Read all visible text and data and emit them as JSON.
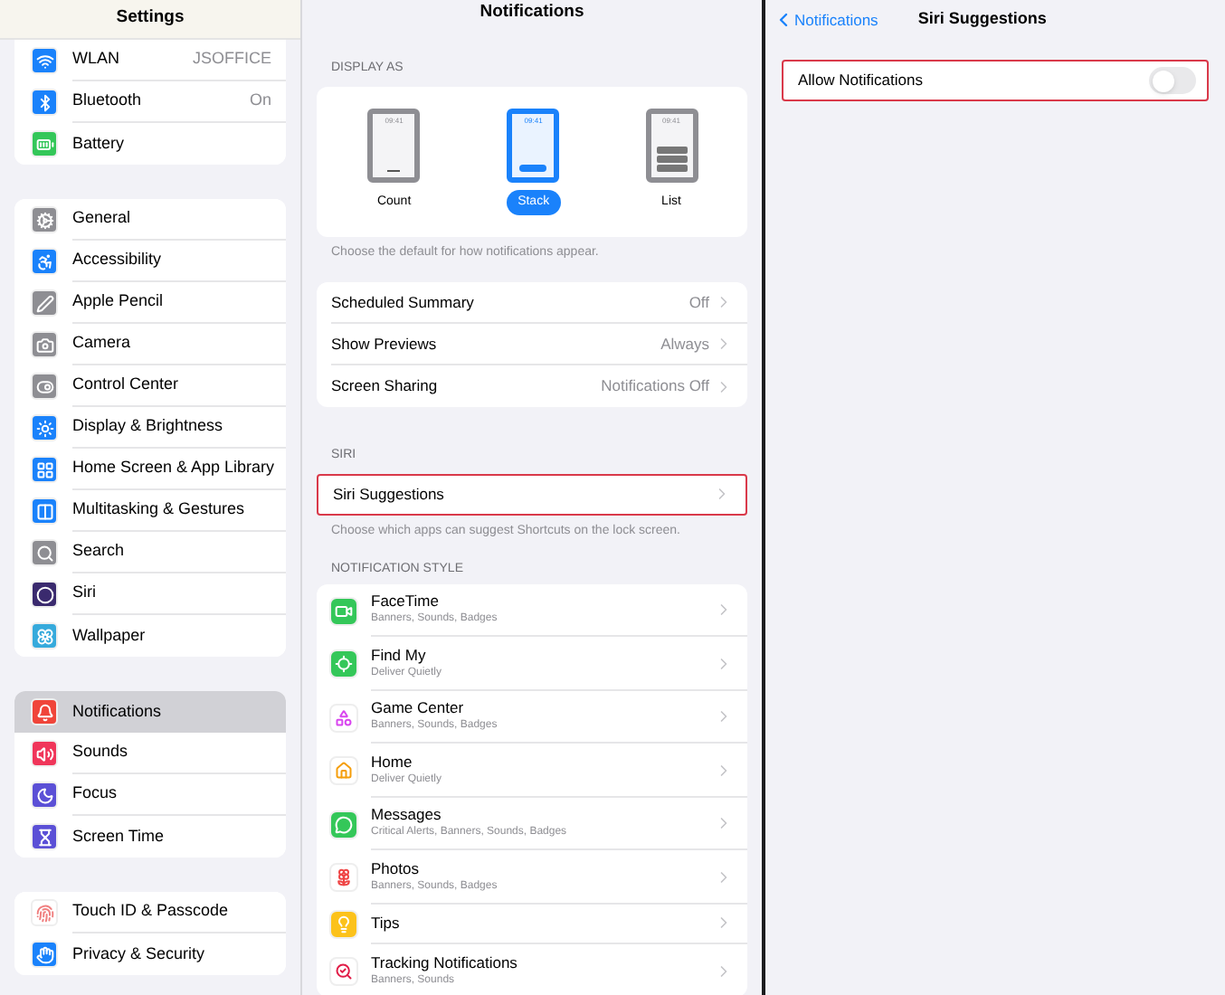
{
  "sidebar": {
    "title": "Settings",
    "groups": [
      [
        {
          "label": "WLAN",
          "value": "JSOFFICE",
          "color": "#1a82fb",
          "selected": false
        },
        {
          "label": "Bluetooth",
          "value": "On",
          "color": "#1a82fb",
          "selected": false
        },
        {
          "label": "Battery",
          "color": "#34c759",
          "selected": false
        }
      ],
      [
        {
          "label": "General",
          "color": "#8e8e93",
          "selected": false
        },
        {
          "label": "Accessibility",
          "color": "#1a82fb",
          "selected": false
        },
        {
          "label": "Apple Pencil",
          "color": "#8e8e93",
          "selected": false
        },
        {
          "label": "Camera",
          "color": "#8e8e93",
          "selected": false
        },
        {
          "label": "Control Center",
          "color": "#8e8e93",
          "selected": false
        },
        {
          "label": "Display & Brightness",
          "color": "#1a82fb",
          "selected": false
        },
        {
          "label": "Home Screen & App Library",
          "color": "#1a82fb",
          "selected": false
        },
        {
          "label": "Multitasking & Gestures",
          "color": "#1a82fb",
          "selected": false
        },
        {
          "label": "Search",
          "color": "#8e8e93",
          "selected": false
        },
        {
          "label": "Siri",
          "color": "#3a2a6e",
          "selected": false
        },
        {
          "label": "Wallpaper",
          "color": "#36aadc",
          "selected": false
        }
      ],
      [
        {
          "label": "Notifications",
          "color": "#f0453a",
          "selected": true
        },
        {
          "label": "Sounds",
          "color": "#f0365a",
          "selected": false
        },
        {
          "label": "Focus",
          "color": "#5b50d6",
          "selected": false
        },
        {
          "label": "Screen Time",
          "color": "#5b50d6",
          "selected": false
        }
      ],
      [
        {
          "label": "Touch ID & Passcode",
          "color": "#ffffff",
          "selected": false
        },
        {
          "label": "Privacy & Security",
          "color": "#1a82fb",
          "selected": false
        }
      ]
    ]
  },
  "notifications": {
    "title": "Notifications",
    "display_as": {
      "header": "DISPLAY AS",
      "options": [
        {
          "label": "Count",
          "time": "09:41",
          "selected": false
        },
        {
          "label": "Stack",
          "time": "09:41",
          "selected": true
        },
        {
          "label": "List",
          "time": "09:41",
          "selected": false
        }
      ],
      "footer": "Choose the default for how notifications appear."
    },
    "settings": [
      {
        "label": "Scheduled Summary",
        "value": "Off"
      },
      {
        "label": "Show Previews",
        "value": "Always"
      },
      {
        "label": "Screen Sharing",
        "value": "Notifications Off"
      }
    ],
    "siri": {
      "header": "SIRI",
      "label": "Siri Suggestions",
      "highlighted": true,
      "footer": "Choose which apps can suggest Shortcuts on the lock screen."
    },
    "style_header": "NOTIFICATION STYLE",
    "apps": [
      {
        "name": "FaceTime",
        "detail": "Banners, Sounds, Badges",
        "color": "#34c759"
      },
      {
        "name": "Find My",
        "detail": "Deliver Quietly",
        "color": "#34c759"
      },
      {
        "name": "Game Center",
        "detail": "Banners, Sounds, Badges",
        "color": "#ffffff"
      },
      {
        "name": "Home",
        "detail": "Deliver Quietly",
        "color": "#ffffff"
      },
      {
        "name": "Messages",
        "detail": "Critical Alerts, Banners, Sounds, Badges",
        "color": "#34c759"
      },
      {
        "name": "Photos",
        "detail": "Banners, Sounds, Badges",
        "color": "#ffffff"
      },
      {
        "name": "Tips",
        "color": "#fcc21b"
      },
      {
        "name": "Tracking Notifications",
        "detail": "Banners, Sounds",
        "color": "#ffffff"
      }
    ]
  },
  "detail": {
    "back": "Notifications",
    "title": "Siri Suggestions",
    "toggle": {
      "label": "Allow Notifications",
      "on": false,
      "highlighted": true
    }
  }
}
